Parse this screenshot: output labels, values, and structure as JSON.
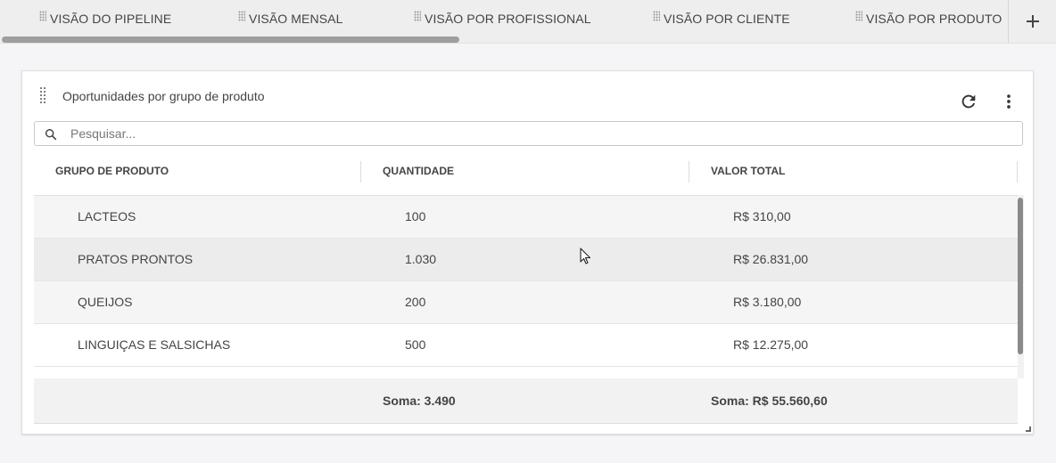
{
  "tabs": [
    {
      "label": "VISÃO DO PIPELINE"
    },
    {
      "label": "VISÃO MENSAL"
    },
    {
      "label": "VISÃO POR PROFISSIONAL"
    },
    {
      "label": "VISÃO POR CLIENTE"
    },
    {
      "label": "VISÃO POR PRODUTO"
    }
  ],
  "add_tab_icon": "plus-icon",
  "widget": {
    "title": "Oportunidades por grupo de produto",
    "icons": {
      "drag": "drag-handle-icon",
      "refresh": "refresh-icon",
      "menu": "more-vert-icon",
      "search": "search-icon"
    },
    "search_placeholder": "Pesquisar...",
    "columns": [
      "GRUPO DE PRODUTO",
      "QUANTIDADE",
      "VALOR TOTAL"
    ],
    "rows": [
      {
        "grupo": "LACTEOS",
        "quantidade": "100",
        "valor": "R$ 310,00"
      },
      {
        "grupo": "PRATOS PRONTOS",
        "quantidade": "1.030",
        "valor": "R$ 26.831,00"
      },
      {
        "grupo": "QUEIJOS",
        "quantidade": "200",
        "valor": "R$ 3.180,00"
      },
      {
        "grupo": "LINGUIÇAS E SALSICHAS",
        "quantidade": "500",
        "valor": "R$ 12.275,00"
      }
    ],
    "footer": {
      "quantidade": "Soma: 3.490",
      "valor": "Soma: R$ 55.560,60"
    }
  },
  "colors": {
    "row_alt": "#f5f5f5",
    "row_hover": "#ececec",
    "scroll_thumb": "#9e9e9e"
  }
}
